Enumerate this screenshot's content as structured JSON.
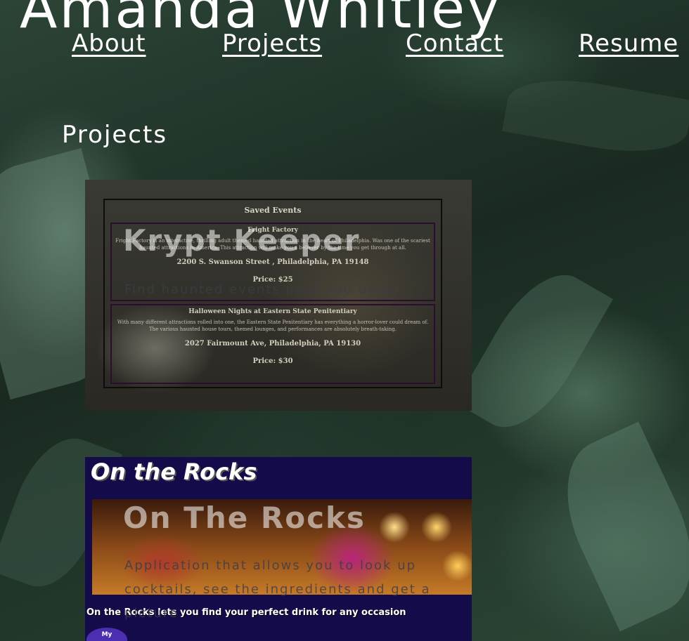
{
  "site": {
    "title": "Amanda Whitley"
  },
  "nav": {
    "items": [
      "About",
      "Projects",
      "Contact",
      "Resume"
    ]
  },
  "section": {
    "title": "Projects"
  },
  "projects": [
    {
      "title": "Krypt Keeper",
      "description": "Find haunted events near you using",
      "screenshot": {
        "heading": "Saved Events",
        "events": [
          {
            "name": "Fright Factory",
            "description": "Fright Factory is an interactive, thrilling adult themed haunted attraction in the heart of Philadelphia. Was one of the scariest haunted attractions in America. This attraction will make you a believer by the time you get through at all.",
            "address": "2200 S. Swanson Street , Philadelphia, PA 19148",
            "price": "Price: $25"
          },
          {
            "name": "Halloween Nights at Eastern State Penitentiary",
            "description": "With many different attractions rolled into one, the Eastern State Penitentiary has everything a horror-lover could dream of. The various haunted house tours, themed lounges, and performances are absolutely breath-taking.",
            "address": "2027 Fairmount Ave, Philadelphia, PA 19130",
            "price": "Price: $30"
          }
        ]
      }
    },
    {
      "title": "On The Rocks",
      "description": "Application that allows you to look up cocktails, see the ingredients and get a picture",
      "screenshot": {
        "logo": "On the Rocks",
        "tagline": "On the Rocks lets you find your perfect drink for any occasion",
        "button": "My"
      }
    }
  ]
}
